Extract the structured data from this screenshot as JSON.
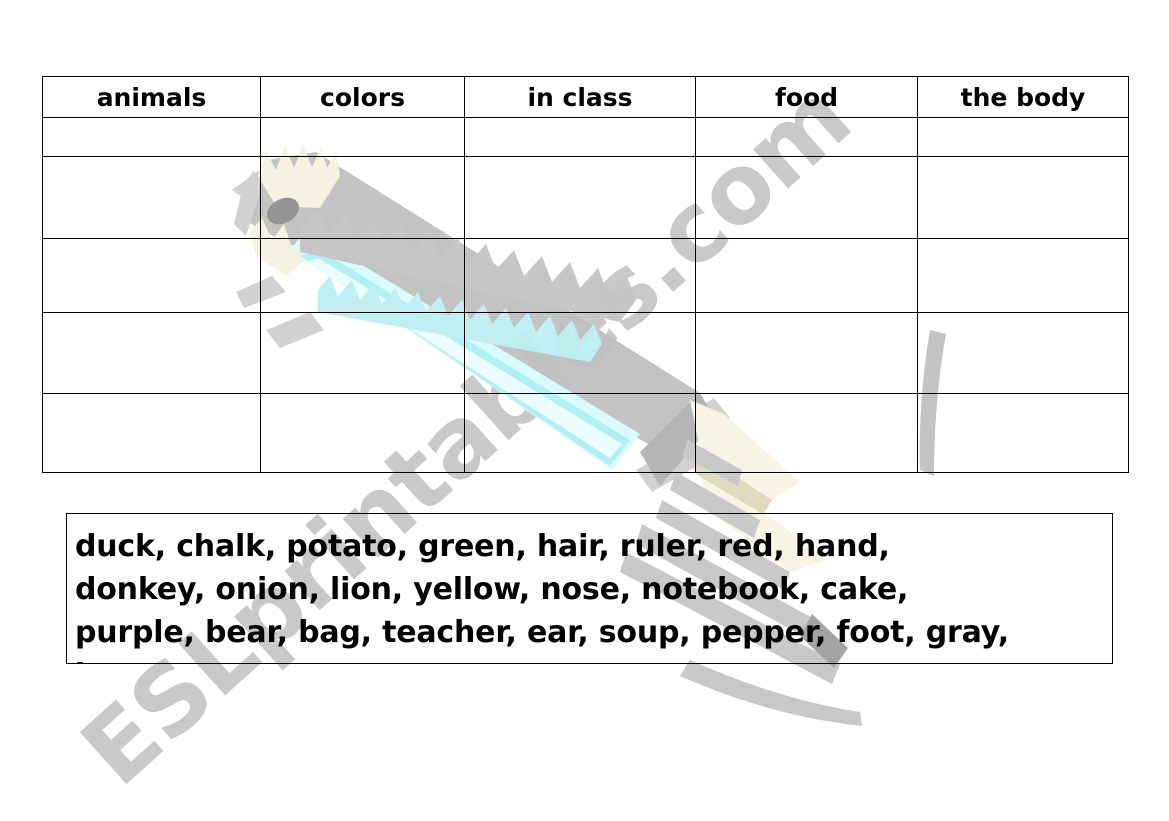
{
  "worksheet": {
    "table": {
      "headers": [
        "animals",
        "colors",
        "in class",
        "food",
        "the body"
      ],
      "body_rows": [
        [
          "",
          "",
          "",
          "",
          ""
        ],
        [
          "",
          "",
          "",
          "",
          ""
        ],
        [
          "",
          "",
          "",
          "",
          ""
        ],
        [
          "",
          "",
          "",
          "",
          ""
        ],
        [
          "",
          "",
          "",
          "",
          ""
        ]
      ]
    },
    "word_bank": {
      "lines": [
        "duck, chalk, potato, green, hair, ruler, red, hand,",
        "donkey, onion, lion, yellow, nose, notebook, cake,",
        "purple, bear, bag, teacher, ear, soup, pepper, foot, gray,",
        "i"
      ]
    },
    "watermark": {
      "text": "ESLprintables.com",
      "color": "#c9c9c9",
      "pencil": {
        "body_color": "#c0c0c0",
        "shadow_color": "#a8a8a8",
        "stripe_color": "#b6f4f7",
        "stripe_highlight": "#e0fbfc",
        "tip_color": "#f5f2e0",
        "eraser_color": "#8f8f8f"
      }
    }
  }
}
